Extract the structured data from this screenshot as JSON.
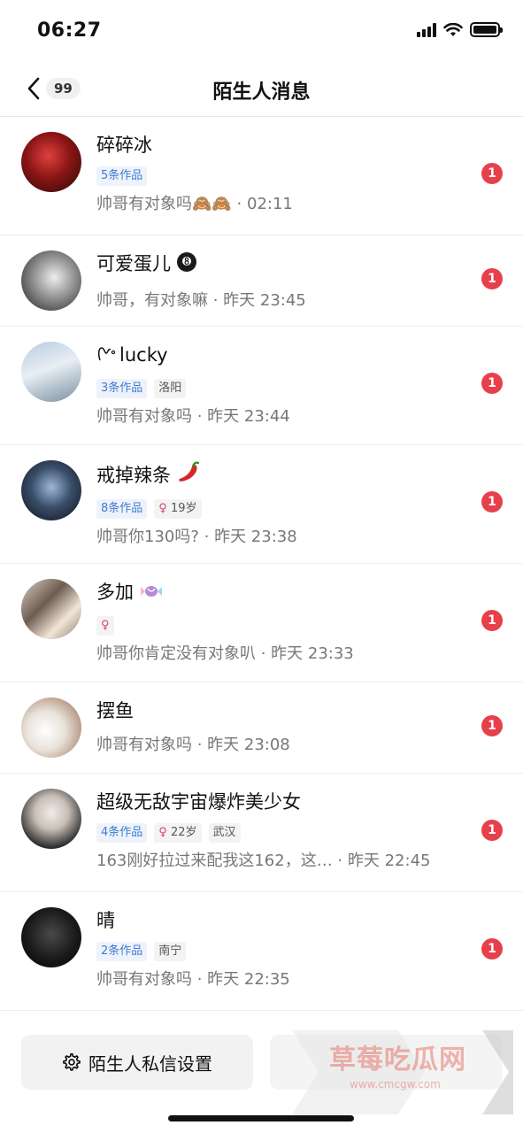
{
  "status_bar": {
    "time": "06:27"
  },
  "nav": {
    "back_count": "99",
    "title": "陌生人消息"
  },
  "messages": [
    {
      "name": "碎碎冰",
      "tags": [
        "5条作品"
      ],
      "preview": "帅哥有对象吗🙈🙈 · 02:11",
      "unread": "1"
    },
    {
      "name": "可爱蛋儿",
      "tags": [],
      "preview": "帅哥，有对象嘛 · 昨天 23:45",
      "unread": "1"
    },
    {
      "name": "lucky",
      "tags": [
        "3条作品",
        "洛阳"
      ],
      "preview": "帅哥有对象吗 · 昨天 23:44",
      "unread": "1"
    },
    {
      "name": "戒掉辣条",
      "tags": [
        "8条作品",
        "19岁"
      ],
      "preview": "帅哥你130吗? · 昨天 23:38",
      "unread": "1"
    },
    {
      "name": "多加",
      "tags": [],
      "preview": "帅哥你肯定没有对象叭 · 昨天 23:33",
      "unread": "1"
    },
    {
      "name": "摆鱼",
      "tags": [],
      "preview": "帅哥有对象吗 · 昨天 23:08",
      "unread": "1"
    },
    {
      "name": "超级无敌宇宙爆炸美少女",
      "tags": [
        "4条作品",
        "22岁",
        "武汉"
      ],
      "preview": "163刚好拉过来配我这162，这… · 昨天 22:45",
      "unread": "1"
    },
    {
      "name": "晴",
      "tags": [
        "2条作品",
        "南宁"
      ],
      "preview": "帅哥有对象吗 · 昨天 22:35",
      "unread": "1"
    }
  ],
  "bottom": {
    "settings_label": "陌生人私信设置"
  },
  "watermark": {
    "text": "草莓吃瓜网",
    "sub": "www.cmcgw.com"
  },
  "colors": {
    "badge": "#e7404a",
    "works_tag": "#3f7bd0",
    "female_symbol": "#d4436b"
  }
}
